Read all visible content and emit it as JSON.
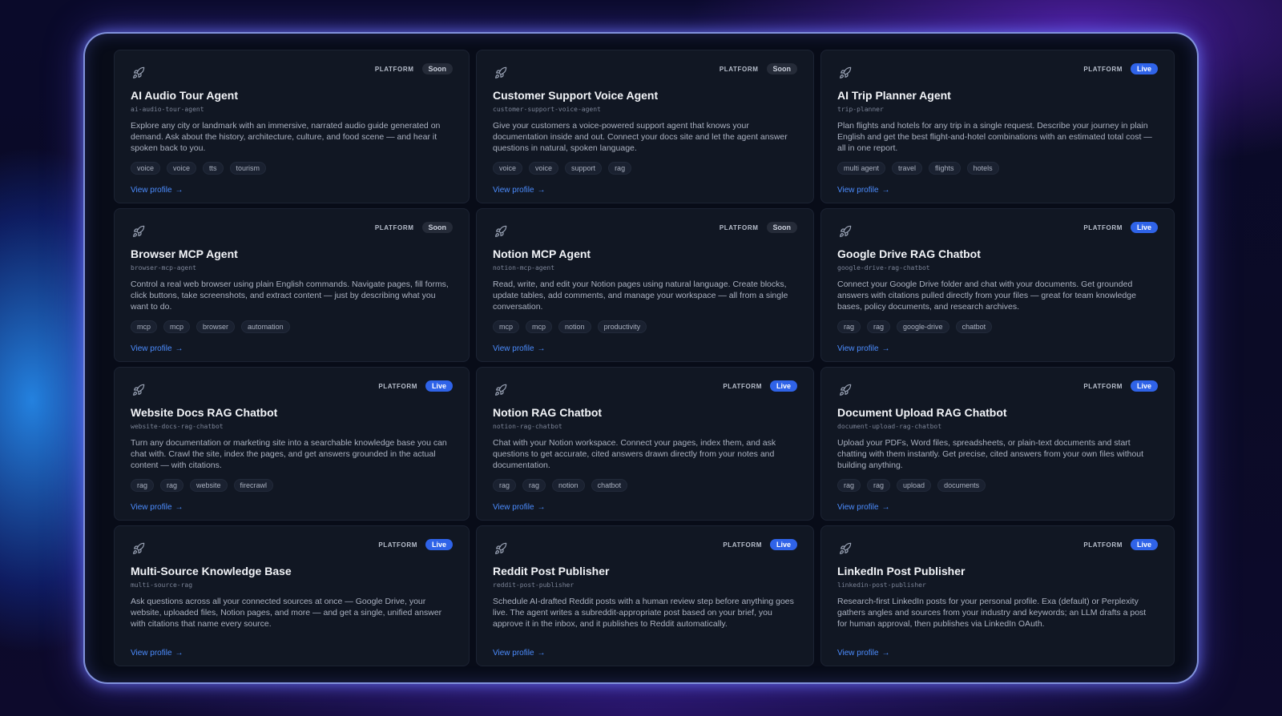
{
  "cards": [
    {
      "platform": "PLATFORM",
      "status": "Soon",
      "status_kind": "soon",
      "title": "AI Audio Tour Agent",
      "slug": "ai-audio-tour-agent",
      "desc": "Explore any city or landmark with an immersive, narrated audio guide generated on demand. Ask about the history, architecture, culture, and food scene — and hear it spoken back to you.",
      "tags": [
        "voice",
        "voice",
        "tts",
        "tourism"
      ],
      "link": "View profile"
    },
    {
      "platform": "PLATFORM",
      "status": "Soon",
      "status_kind": "soon",
      "title": "Customer Support Voice Agent",
      "slug": "customer-support-voice-agent",
      "desc": "Give your customers a voice-powered support agent that knows your documentation inside and out. Connect your docs site and let the agent answer questions in natural, spoken language.",
      "tags": [
        "voice",
        "voice",
        "support",
        "rag"
      ],
      "link": "View profile"
    },
    {
      "platform": "PLATFORM",
      "status": "Live",
      "status_kind": "live",
      "title": "AI Trip Planner Agent",
      "slug": "trip-planner",
      "desc": "Plan flights and hotels for any trip in a single request. Describe your journey in plain English and get the best flight-and-hotel combinations with an estimated total cost — all in one report.",
      "tags": [
        "multi agent",
        "travel",
        "flights",
        "hotels"
      ],
      "link": "View profile"
    },
    {
      "platform": "PLATFORM",
      "status": "Soon",
      "status_kind": "soon",
      "title": "Browser MCP Agent",
      "slug": "browser-mcp-agent",
      "desc": "Control a real web browser using plain English commands. Navigate pages, fill forms, click buttons, take screenshots, and extract content — just by describing what you want to do.",
      "tags": [
        "mcp",
        "mcp",
        "browser",
        "automation"
      ],
      "link": "View profile"
    },
    {
      "platform": "PLATFORM",
      "status": "Soon",
      "status_kind": "soon",
      "title": "Notion MCP Agent",
      "slug": "notion-mcp-agent",
      "desc": "Read, write, and edit your Notion pages using natural language. Create blocks, update tables, add comments, and manage your workspace — all from a single conversation.",
      "tags": [
        "mcp",
        "mcp",
        "notion",
        "productivity"
      ],
      "link": "View profile"
    },
    {
      "platform": "PLATFORM",
      "status": "Live",
      "status_kind": "live",
      "title": "Google Drive RAG Chatbot",
      "slug": "google-drive-rag-chatbot",
      "desc": "Connect your Google Drive folder and chat with your documents. Get grounded answers with citations pulled directly from your files — great for team knowledge bases, policy documents, and research archives.",
      "tags": [
        "rag",
        "rag",
        "google-drive",
        "chatbot"
      ],
      "link": "View profile"
    },
    {
      "platform": "PLATFORM",
      "status": "Live",
      "status_kind": "live",
      "title": "Website Docs RAG Chatbot",
      "slug": "website-docs-rag-chatbot",
      "desc": "Turn any documentation or marketing site into a searchable knowledge base you can chat with. Crawl the site, index the pages, and get answers grounded in the actual content — with citations.",
      "tags": [
        "rag",
        "rag",
        "website",
        "firecrawl"
      ],
      "link": "View profile"
    },
    {
      "platform": "PLATFORM",
      "status": "Live",
      "status_kind": "live",
      "title": "Notion RAG Chatbot",
      "slug": "notion-rag-chatbot",
      "desc": "Chat with your Notion workspace. Connect your pages, index them, and ask questions to get accurate, cited answers drawn directly from your notes and documentation.",
      "tags": [
        "rag",
        "rag",
        "notion",
        "chatbot"
      ],
      "link": "View profile"
    },
    {
      "platform": "PLATFORM",
      "status": "Live",
      "status_kind": "live",
      "title": "Document Upload RAG Chatbot",
      "slug": "document-upload-rag-chatbot",
      "desc": "Upload your PDFs, Word files, spreadsheets, or plain-text documents and start chatting with them instantly. Get precise, cited answers from your own files without building anything.",
      "tags": [
        "rag",
        "rag",
        "upload",
        "documents"
      ],
      "link": "View profile"
    },
    {
      "platform": "PLATFORM",
      "status": "Live",
      "status_kind": "live",
      "title": "Multi-Source Knowledge Base",
      "slug": "multi-source-rag",
      "desc": "Ask questions across all your connected sources at once — Google Drive, your website, uploaded files, Notion pages, and more — and get a single, unified answer with citations that name every source.",
      "tags": [],
      "link": "View profile"
    },
    {
      "platform": "PLATFORM",
      "status": "Live",
      "status_kind": "live",
      "title": "Reddit Post Publisher",
      "slug": "reddit-post-publisher",
      "desc": "Schedule AI-drafted Reddit posts with a human review step before anything goes live. The agent writes a subreddit-appropriate post based on your brief, you approve it in the inbox, and it publishes to Reddit automatically.",
      "tags": [],
      "link": "View profile"
    },
    {
      "platform": "PLATFORM",
      "status": "Live",
      "status_kind": "live",
      "title": "LinkedIn Post Publisher",
      "slug": "linkedin-post-publisher",
      "desc": "Research-first LinkedIn posts for your personal profile. Exa (default) or Perplexity gathers angles and sources from your industry and keywords; an LLM drafts a post for human approval, then publishes via LinkedIn OAuth.",
      "tags": [],
      "link": "View profile"
    }
  ]
}
